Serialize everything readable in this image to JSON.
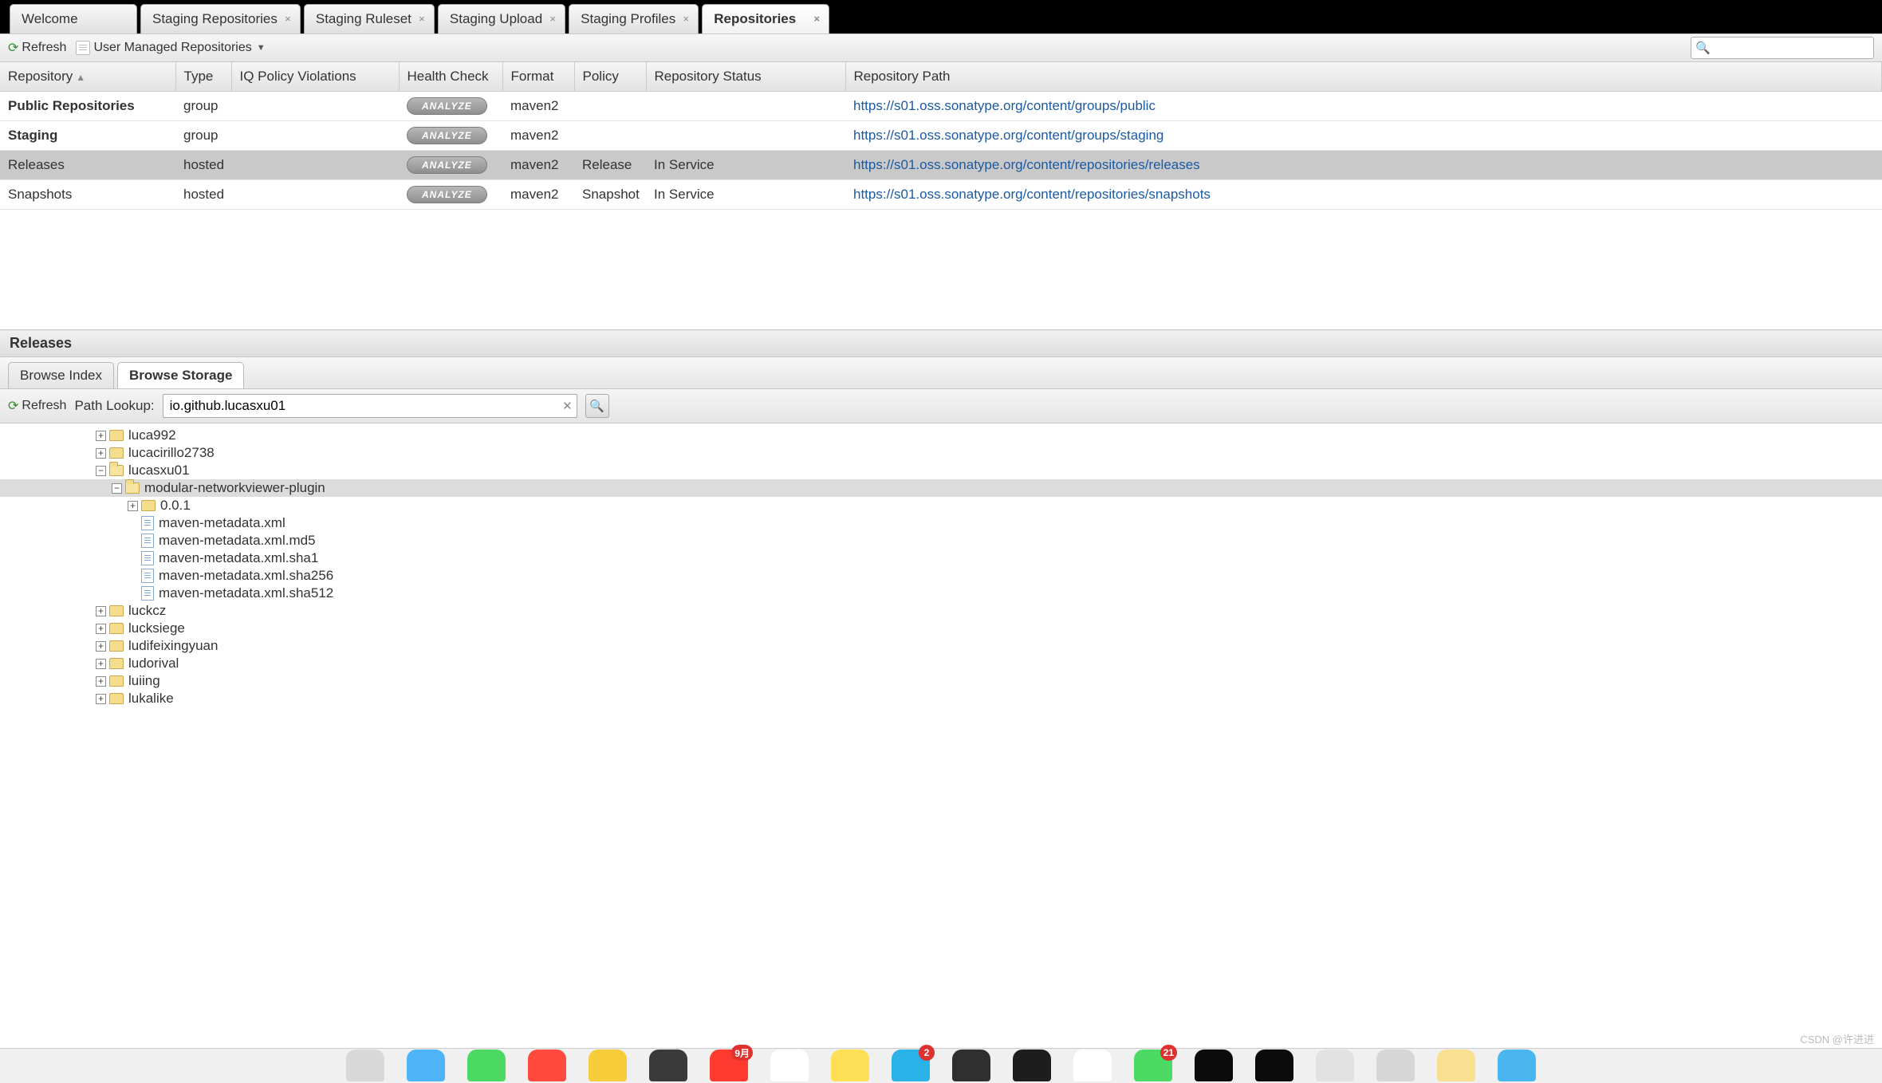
{
  "tabs": [
    {
      "label": "Welcome",
      "closable": false,
      "active": false
    },
    {
      "label": "Staging Repositories",
      "closable": true,
      "active": false
    },
    {
      "label": "Staging Ruleset",
      "closable": true,
      "active": false
    },
    {
      "label": "Staging Upload",
      "closable": true,
      "active": false
    },
    {
      "label": "Staging Profiles",
      "closable": true,
      "active": false
    },
    {
      "label": "Repositories",
      "closable": true,
      "active": true
    }
  ],
  "toolbar": {
    "refresh_label": "Refresh",
    "user_managed_label": "User Managed Repositories"
  },
  "search": {
    "placeholder": ""
  },
  "columns": [
    "Repository",
    "Type",
    "IQ Policy Violations",
    "Health Check",
    "Format",
    "Policy",
    "Repository Status",
    "Repository Path"
  ],
  "rows": [
    {
      "repository": "Public Repositories",
      "bold": true,
      "type": "group",
      "iq": "",
      "health": "ANALYZE",
      "format": "maven2",
      "policy": "",
      "status": "",
      "path": "https://s01.oss.sonatype.org/content/groups/public",
      "selected": false
    },
    {
      "repository": "Staging",
      "bold": true,
      "type": "group",
      "iq": "",
      "health": "ANALYZE",
      "format": "maven2",
      "policy": "",
      "status": "",
      "path": "https://s01.oss.sonatype.org/content/groups/staging",
      "selected": false
    },
    {
      "repository": "Releases",
      "bold": false,
      "type": "hosted",
      "iq": "",
      "health": "ANALYZE",
      "format": "maven2",
      "policy": "Release",
      "status": "In Service",
      "path": "https://s01.oss.sonatype.org/content/repositories/releases",
      "selected": true
    },
    {
      "repository": "Snapshots",
      "bold": false,
      "type": "hosted",
      "iq": "",
      "health": "ANALYZE",
      "format": "maven2",
      "policy": "Snapshot",
      "status": "In Service",
      "path": "https://s01.oss.sonatype.org/content/repositories/snapshots",
      "selected": false
    }
  ],
  "detail": {
    "title": "Releases",
    "subtabs": [
      {
        "label": "Browse Index",
        "active": false
      },
      {
        "label": "Browse Storage",
        "active": true
      }
    ],
    "refresh_label": "Refresh",
    "path_lookup_label": "Path Lookup:",
    "path_lookup_value": "io.github.lucasxu01"
  },
  "tree": [
    {
      "indent": 3,
      "toggle": "plus",
      "icon": "folder",
      "label": "luca992"
    },
    {
      "indent": 3,
      "toggle": "plus",
      "icon": "folder",
      "label": "lucacirillo2738"
    },
    {
      "indent": 3,
      "toggle": "minus",
      "icon": "folder-open",
      "label": "lucasxu01"
    },
    {
      "indent": 4,
      "toggle": "minus",
      "icon": "folder-open",
      "label": "modular-networkviewer-plugin",
      "selected": true
    },
    {
      "indent": 5,
      "toggle": "plus",
      "icon": "folder",
      "label": "0.0.1"
    },
    {
      "indent": 5,
      "toggle": "none",
      "icon": "file",
      "label": "maven-metadata.xml"
    },
    {
      "indent": 5,
      "toggle": "none",
      "icon": "file",
      "label": "maven-metadata.xml.md5"
    },
    {
      "indent": 5,
      "toggle": "none",
      "icon": "file",
      "label": "maven-metadata.xml.sha1"
    },
    {
      "indent": 5,
      "toggle": "none",
      "icon": "file",
      "label": "maven-metadata.xml.sha256"
    },
    {
      "indent": 5,
      "toggle": "none",
      "icon": "file",
      "label": "maven-metadata.xml.sha512"
    },
    {
      "indent": 3,
      "toggle": "plus",
      "icon": "folder",
      "label": "luckcz"
    },
    {
      "indent": 3,
      "toggle": "plus",
      "icon": "folder",
      "label": "lucksiege"
    },
    {
      "indent": 3,
      "toggle": "plus",
      "icon": "folder",
      "label": "ludifeixingyuan"
    },
    {
      "indent": 3,
      "toggle": "plus",
      "icon": "folder",
      "label": "ludorival"
    },
    {
      "indent": 3,
      "toggle": "plus",
      "icon": "folder",
      "label": "luiing"
    },
    {
      "indent": 3,
      "toggle": "plus",
      "icon": "folder",
      "label": "lukalike"
    }
  ],
  "dock": [
    {
      "color": "#d8d8d8"
    },
    {
      "color": "#4fb3f7"
    },
    {
      "color": "#4bd964"
    },
    {
      "color": "#ff4a3d"
    },
    {
      "color": "#f7cc3a"
    },
    {
      "color": "#3a3a3a"
    },
    {
      "color": "#ff3b30",
      "badge": "9月"
    },
    {
      "color": "#ffffff"
    },
    {
      "color": "#ffdf55"
    },
    {
      "color": "#2ab3e8",
      "badge": "2"
    },
    {
      "color": "#2f2f2f"
    },
    {
      "color": "#1d1d1d"
    },
    {
      "color": "#ffffff"
    },
    {
      "color": "#4cd964",
      "badge": "21"
    },
    {
      "color": "#0b0b0b"
    },
    {
      "color": "#0b0b0b"
    },
    {
      "color": "#e2e2e2"
    },
    {
      "color": "#d6d6d6"
    },
    {
      "color": "#f9e090"
    },
    {
      "color": "#49b6ef"
    }
  ],
  "watermark": "CSDN @许进进"
}
